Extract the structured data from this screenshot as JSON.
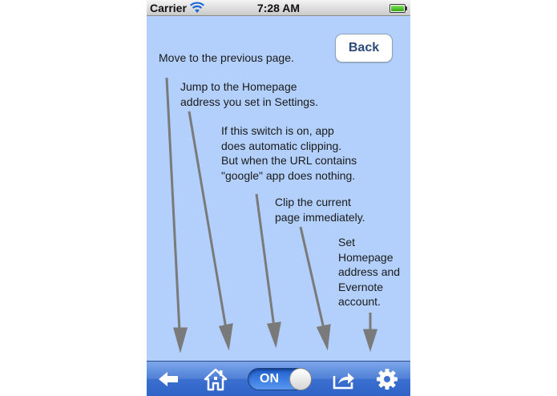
{
  "status_bar": {
    "carrier": "Carrier",
    "time": "7:28 AM",
    "wifi_icon": "wifi-icon",
    "battery_icon": "battery-icon"
  },
  "nav": {
    "back_label": "Back"
  },
  "annotations": {
    "back": "Move to the previous page.",
    "home": "Jump to the Homepage\naddress you set in Settings.",
    "switch": "If this switch is on, app\ndoes automatic clipping.\nBut when the URL contains\n\"google\" app does nothing.",
    "clip": "Clip the current\npage immediately.",
    "settings": "Set\nHomepage\naddress and\nEvernote\naccount."
  },
  "toolbar": {
    "items": [
      "back-arrow-icon",
      "home-icon",
      "auto-clip-switch",
      "share-icon",
      "gear-icon"
    ],
    "switch_label": "ON",
    "switch_on": true
  },
  "colors": {
    "background": "#b2d0fb",
    "toolbar": "#3b6fd0",
    "arrow": "#7a7a7a",
    "button_text": "#2c4a78"
  }
}
